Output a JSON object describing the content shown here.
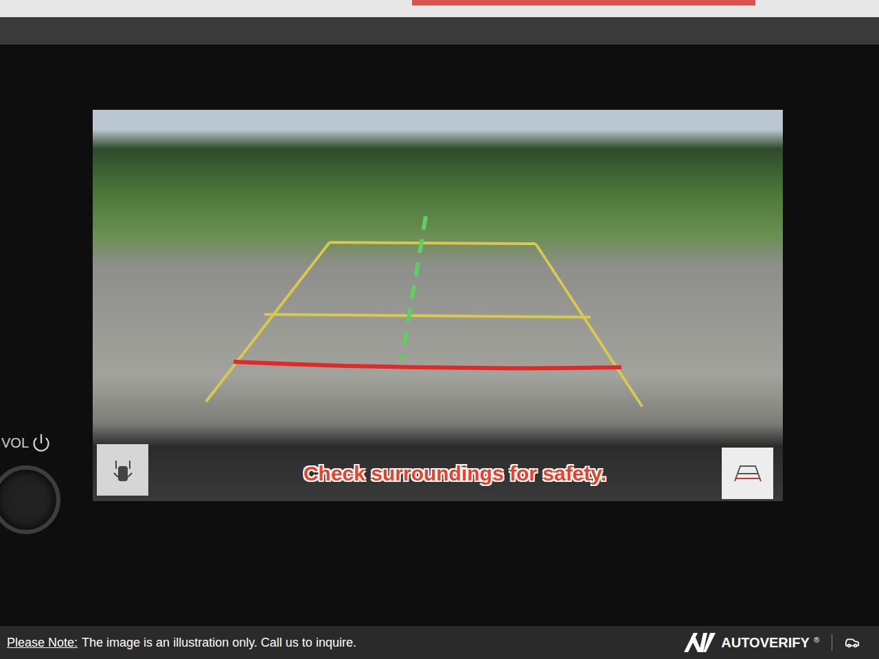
{
  "display": {
    "volume_label": "VOL"
  },
  "camera": {
    "warning": "Check surroundings for safety."
  },
  "footer": {
    "note_label": "Please Note:",
    "note": "The image is an illustration only. Call us to inquire.",
    "brand": "AUTOVERIFY",
    "brand_mark": "®"
  }
}
